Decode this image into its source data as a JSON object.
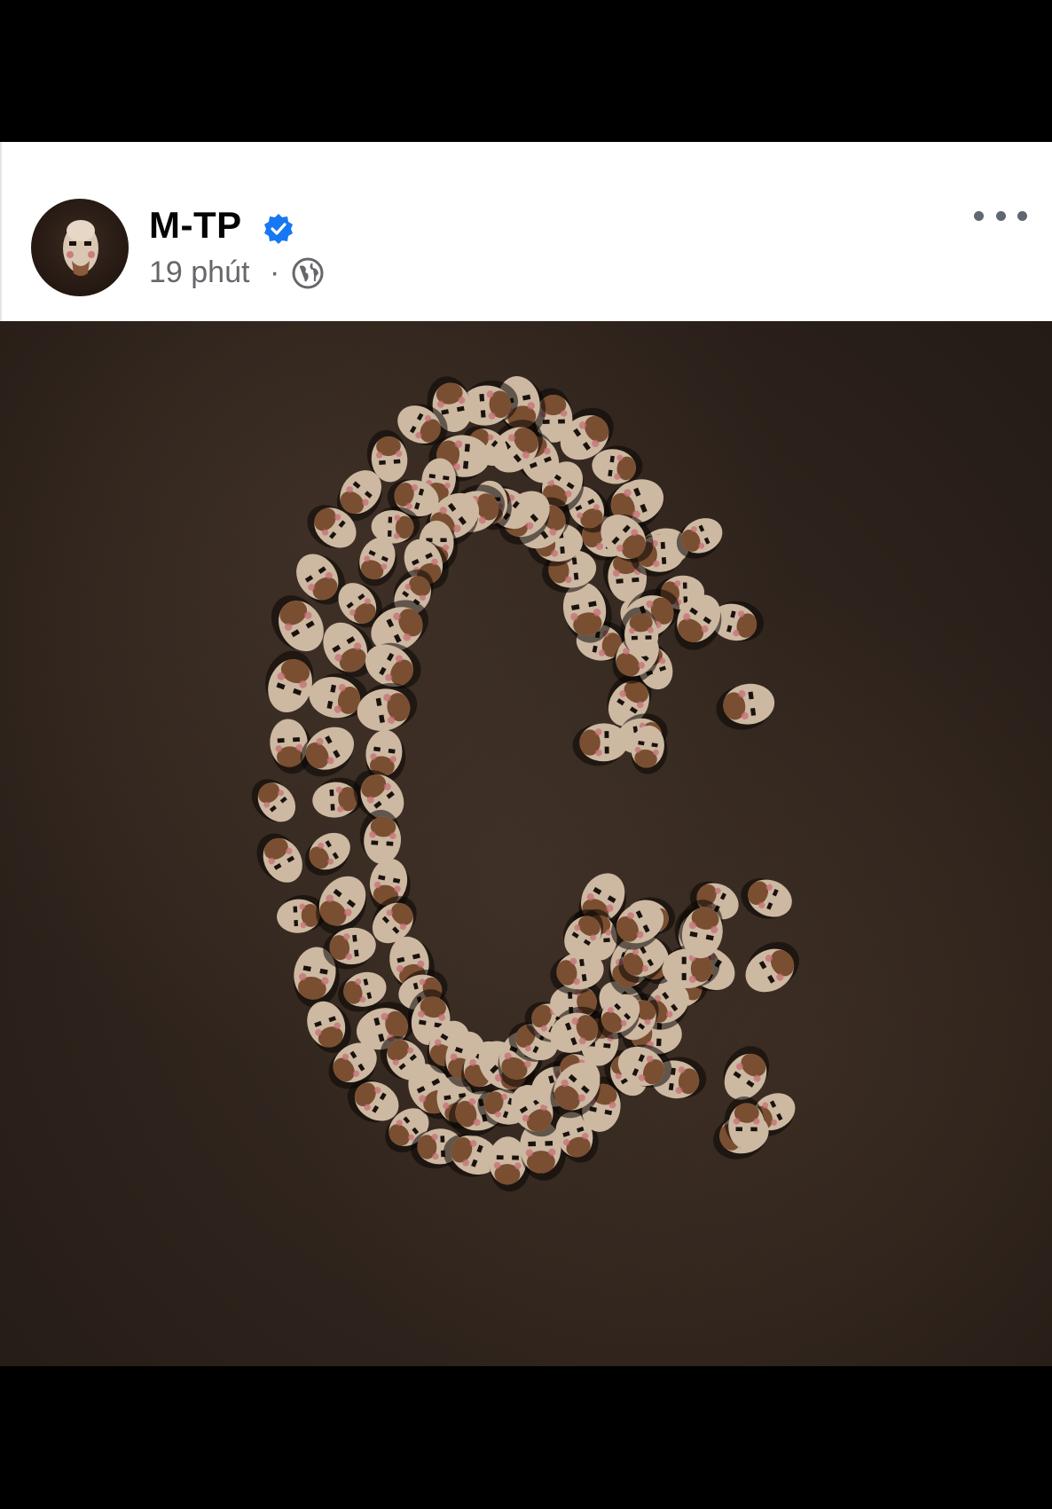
{
  "post": {
    "author_name": "M-TP",
    "time": "19 phút",
    "separator": "·",
    "privacy_icon": "globe-icon",
    "verified_icon": "verified-badge-icon",
    "more_icon": "more-options-icon"
  },
  "colors": {
    "verified_blue": "#1877f2",
    "meta_text": "#65676b",
    "name_text": "#050505"
  }
}
